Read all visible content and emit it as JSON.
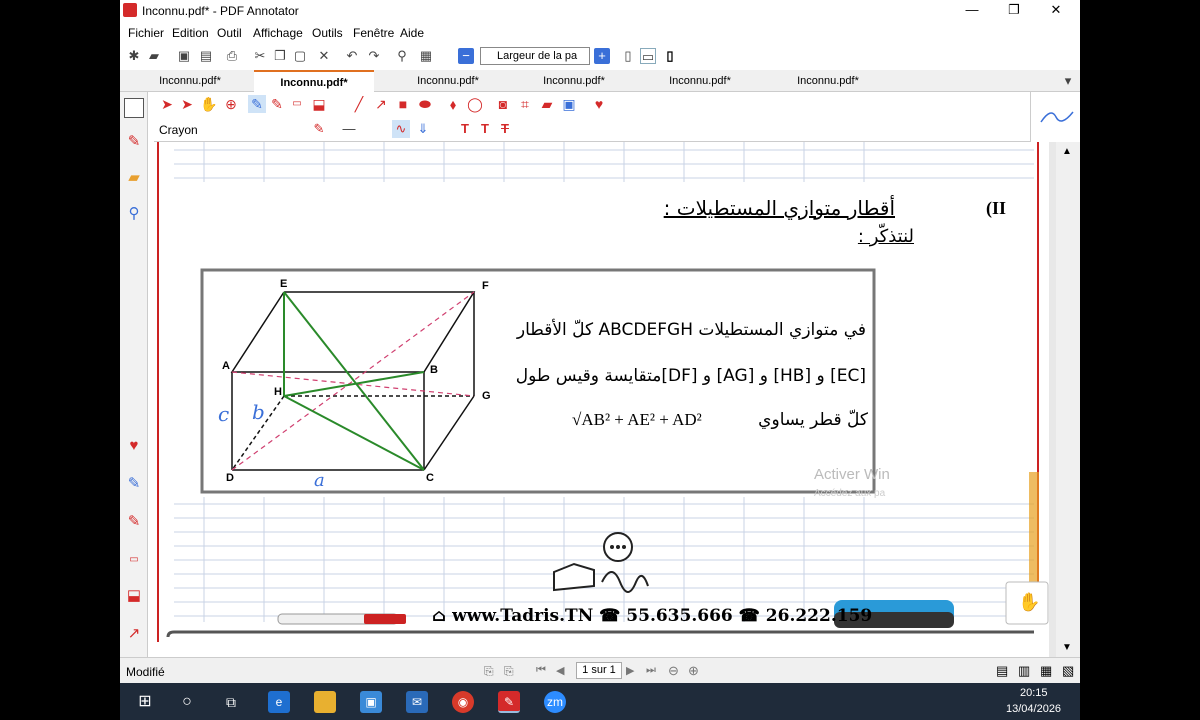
{
  "window": {
    "title": "Inconnu.pdf* - PDF Annotator",
    "minimize_glyph": "—",
    "maximize_glyph": "❐",
    "close_glyph": "✕"
  },
  "menu": [
    "Fichier",
    "Edition",
    "Outil",
    "Affichage",
    "Outils",
    "Fenêtre",
    "Aide"
  ],
  "toolbar": {
    "zoom_value": "Largeur de la pa"
  },
  "tabs": [
    "Inconnu.pdf*",
    "Inconnu.pdf*",
    "Inconnu.pdf*",
    "Inconnu.pdf*",
    "Inconnu.pdf*",
    "Inconnu.pdf*"
  ],
  "active_tab_index": 1,
  "tool": {
    "current_label": "Crayon"
  },
  "document": {
    "section_title": "أقطار متوازي المستطيلات :",
    "section_number": "(II",
    "recall_label": "لنتذكّر :",
    "line1": "في متوازي المستطيلات ABCDEFGH كلّ الأقطار",
    "line2": "[EC] و [HB] و [AG] و [DF]متقايسة وقيس طول",
    "line3_text": "كلّ قطر يساوي",
    "formula": "√AB² + AE² + AD²",
    "vertices": [
      "E",
      "F",
      "A",
      "B",
      "H",
      "G",
      "D",
      "C"
    ],
    "handwritten_c": "c",
    "handwritten_b": "b",
    "handwritten_a": "a",
    "watermark_line1": "Activer Win",
    "watermark_line2": "Accédez aux pa",
    "footer_site": "www.Tadris.TN",
    "footer_phone1": "55.635.666",
    "footer_phone2": "26.222.159"
  },
  "status": {
    "left_text": "Modifié",
    "page_indicator": "1 sur 1"
  },
  "taskbar": {
    "time": "20:15",
    "date": "13/04/2026",
    "zoom_icon_label": "zm"
  },
  "colors": {
    "accent": "#e07020",
    "red_margin": "#cc2222",
    "green_diag": "#2a8a2a",
    "pink_dashed": "#d04070",
    "blue_ink": "#3a6fd8"
  }
}
